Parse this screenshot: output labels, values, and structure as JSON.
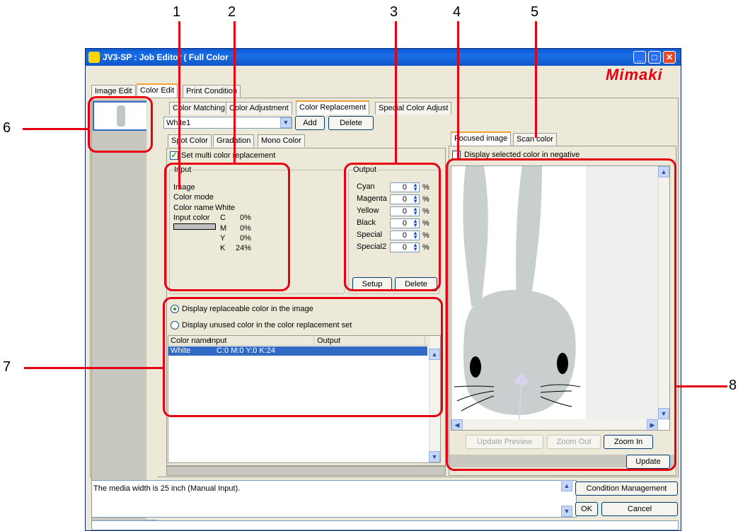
{
  "callouts": [
    "1",
    "2",
    "3",
    "4",
    "5",
    "6",
    "7",
    "8"
  ],
  "window": {
    "title": "JV3-SP : Job Editor ( Full Color",
    "brand": "Mimaki"
  },
  "main_tabs": [
    "Image Edit",
    "Color Edit",
    "Print Condition"
  ],
  "sub_tabs": [
    "Color Matching",
    "Color Adjustment",
    "Color Replacement",
    "Special Color Adjust"
  ],
  "toolbar": {
    "selected_set": "White1",
    "add_label": "Add",
    "delete_label": "Delete"
  },
  "inner_tabs": [
    "Spot Color",
    "Gradation",
    "Mono Color"
  ],
  "multi_replace_label": "Set multi color replacement",
  "input": {
    "label": "Input",
    "image_label": "Image",
    "color_mode_label": "Color mode",
    "color_name_label": "Color name",
    "color_name_value": "White",
    "input_color_label": "Input color",
    "channels": [
      {
        "ch": "C",
        "val": "0%"
      },
      {
        "ch": "M",
        "val": "0%"
      },
      {
        "ch": "Y",
        "val": "0%"
      },
      {
        "ch": "K",
        "val": "24%"
      }
    ],
    "swatch_color": "#c0c0c0"
  },
  "output": {
    "label": "Output",
    "rows": [
      {
        "name": "Cyan",
        "value": "0",
        "unit": "%"
      },
      {
        "name": "Magenta",
        "value": "0",
        "unit": "%"
      },
      {
        "name": "Yellow",
        "value": "0",
        "unit": "%"
      },
      {
        "name": "Black",
        "value": "0",
        "unit": "%"
      },
      {
        "name": "Special",
        "value": "0",
        "unit": "%"
      },
      {
        "name": "Special2",
        "value": "0",
        "unit": "%"
      }
    ],
    "setup_label": "Setup",
    "delete_label": "Delete"
  },
  "display_options": {
    "replaceable": "Display replaceable color in the image",
    "unused": "Display unused color in the color replacement set"
  },
  "color_table": {
    "headers": [
      "Color name",
      "Input",
      "Output"
    ],
    "rows": [
      {
        "name": "White",
        "input": "C:0 M:0 Y:0 K:24",
        "output": ""
      }
    ]
  },
  "preview_tabs": [
    "Focused image",
    "Scan color"
  ],
  "negative_label": "Display selected color in negative",
  "preview_buttons": {
    "update_preview": "Update Preview",
    "zoom_out": "Zoom Out",
    "zoom_in": "Zoom In",
    "update": "Update"
  },
  "status": {
    "message": "The media width is 25 inch (Manual Input).",
    "condition_management": "Condition Management",
    "ok": "OK",
    "cancel": "Cancel"
  },
  "colors": {
    "callout_red": "#e60012",
    "titlebar_blue": "#0a5bd8",
    "bunny_gray": "#c9cfcf",
    "nose_lavender": "#d8d2ee"
  }
}
